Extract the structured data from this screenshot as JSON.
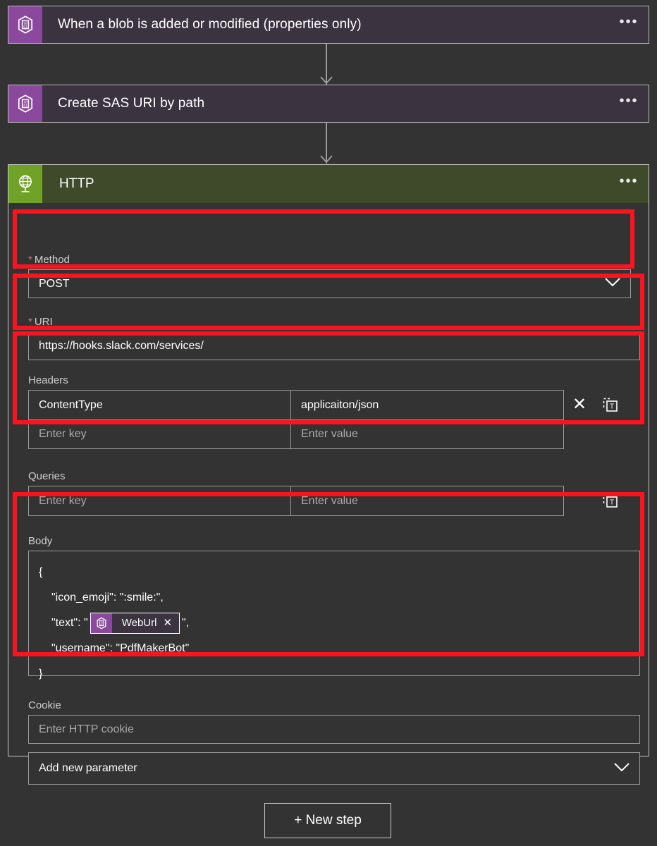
{
  "flow": {
    "steps": [
      {
        "title": "When a blob is added or modified (properties only)",
        "icon": "azure-blob-storage-icon",
        "menu": "•••"
      },
      {
        "title": "Create SAS URI by path",
        "icon": "azure-blob-storage-icon",
        "menu": "•••"
      }
    ]
  },
  "http_card": {
    "title": "HTTP",
    "icon": "globe-icon",
    "menu": "•••",
    "method": {
      "label": "Method",
      "required_marker": "*",
      "value": "POST",
      "chevron": "chevron-down-icon"
    },
    "uri": {
      "label": "URI",
      "required_marker": "*",
      "value": "https://hooks.slack.com/services/"
    },
    "headers": {
      "label": "Headers",
      "rows": [
        {
          "key": "ContentType",
          "value": "applicaiton/json",
          "is_placeholder": false
        },
        {
          "key": "Enter key",
          "value": "Enter value",
          "is_placeholder": true
        }
      ],
      "delete_label": "✕",
      "text_mode_title": "switch-to-text-mode"
    },
    "queries": {
      "label": "Queries",
      "rows": [
        {
          "key": "Enter key",
          "value": "Enter value",
          "is_placeholder": true
        }
      ],
      "text_mode_title": "switch-to-text-mode"
    },
    "body": {
      "label": "Body",
      "lines": [
        {
          "text": "{",
          "indent": 0
        },
        {
          "text": "\"icon_emoji\": \":smile:\",",
          "indent": 1
        },
        {
          "prefix": "\"text\": \"",
          "token": "WebUrl",
          "suffix": "\",",
          "indent": 1,
          "has_token": true
        },
        {
          "text": "\"username\": \"PdfMakerBot\"",
          "indent": 1
        },
        {
          "text": "}",
          "indent": 0
        }
      ],
      "token_remove": "✕"
    },
    "cookie": {
      "label": "Cookie",
      "placeholder": "Enter HTTP cookie"
    },
    "add_parameter": {
      "label": "Add new parameter",
      "chevron": "chevron-down-icon"
    }
  },
  "new_step_button": {
    "label": "+ New step"
  },
  "colors": {
    "background": "#333333",
    "card_header_purple": "#3b3340",
    "icon_purple": "#8a499c",
    "http_header_green": "#3e4a2a",
    "http_icon_green": "#6fa226",
    "highlight_red": "#fb1420",
    "border_gray": "#9b9b9b"
  }
}
